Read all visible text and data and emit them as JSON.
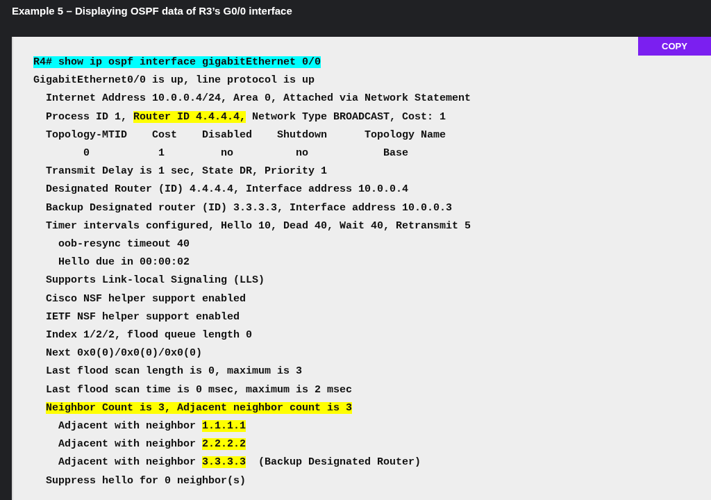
{
  "title": "Example 5 – Displaying OSPF data of R3’s G0/0 interface",
  "copy_button": "COPY",
  "code_lines": [
    {
      "segments": [
        {
          "text": "R4# show ip ospf interface gigabitEthernet 0/0",
          "color": "#00ffff"
        }
      ]
    },
    {
      "segments": [
        {
          "text": "GigabitEthernet0/0 is up, line protocol is up"
        }
      ]
    },
    {
      "segments": [
        {
          "text": "  Internet Address 10.0.0.4/24, Area 0, Attached via Network Statement"
        }
      ]
    },
    {
      "segments": [
        {
          "text": "  Process ID 1, "
        },
        {
          "text": "Router ID 4.4.4.4,",
          "color": "#ffff00"
        },
        {
          "text": " Network Type BROADCAST, Cost: 1"
        }
      ]
    },
    {
      "segments": [
        {
          "text": "  Topology-MTID    Cost    Disabled    Shutdown      Topology Name"
        }
      ]
    },
    {
      "segments": [
        {
          "text": "        0           1         no          no            Base"
        }
      ]
    },
    {
      "segments": [
        {
          "text": "  Transmit Delay is 1 sec, State DR, Priority 1"
        }
      ]
    },
    {
      "segments": [
        {
          "text": "  Designated Router (ID) 4.4.4.4, Interface address 10.0.0.4"
        }
      ]
    },
    {
      "segments": [
        {
          "text": "  Backup Designated router (ID) 3.3.3.3, Interface address 10.0.0.3"
        }
      ]
    },
    {
      "segments": [
        {
          "text": "  Timer intervals configured, Hello 10, Dead 40, Wait 40, Retransmit 5"
        }
      ]
    },
    {
      "segments": [
        {
          "text": "    oob-resync timeout 40"
        }
      ]
    },
    {
      "segments": [
        {
          "text": "    Hello due in 00:00:02"
        }
      ]
    },
    {
      "segments": [
        {
          "text": "  Supports Link-local Signaling (LLS)"
        }
      ]
    },
    {
      "segments": [
        {
          "text": "  Cisco NSF helper support enabled"
        }
      ]
    },
    {
      "segments": [
        {
          "text": "  IETF NSF helper support enabled"
        }
      ]
    },
    {
      "segments": [
        {
          "text": "  Index 1/2/2, flood queue length 0"
        }
      ]
    },
    {
      "segments": [
        {
          "text": "  Next 0x0(0)/0x0(0)/0x0(0)"
        }
      ]
    },
    {
      "segments": [
        {
          "text": "  Last flood scan length is 0, maximum is 3"
        }
      ]
    },
    {
      "segments": [
        {
          "text": "  Last flood scan time is 0 msec, maximum is 2 msec"
        }
      ]
    },
    {
      "kind": "indented",
      "segments": [
        {
          "text": "Neighbor Count is 3, Adjacent neighbor count is 3",
          "color": "#ffff00"
        }
      ]
    },
    {
      "segments": [
        {
          "text": "    Adjacent with neighbor "
        },
        {
          "text": "1.1.1.1",
          "color": "#ffff00"
        }
      ]
    },
    {
      "segments": [
        {
          "text": "    Adjacent with neighbor "
        },
        {
          "text": "2.2.2.2",
          "color": "#ffff00"
        }
      ]
    },
    {
      "segments": [
        {
          "text": "    Adjacent with neighbor "
        },
        {
          "text": "3.3.3.3",
          "color": "#ffff00"
        },
        {
          "text": "  (Backup Designated Router)"
        }
      ]
    },
    {
      "segments": [
        {
          "text": "  Suppress hello for 0 neighbor(s)"
        }
      ]
    }
  ]
}
